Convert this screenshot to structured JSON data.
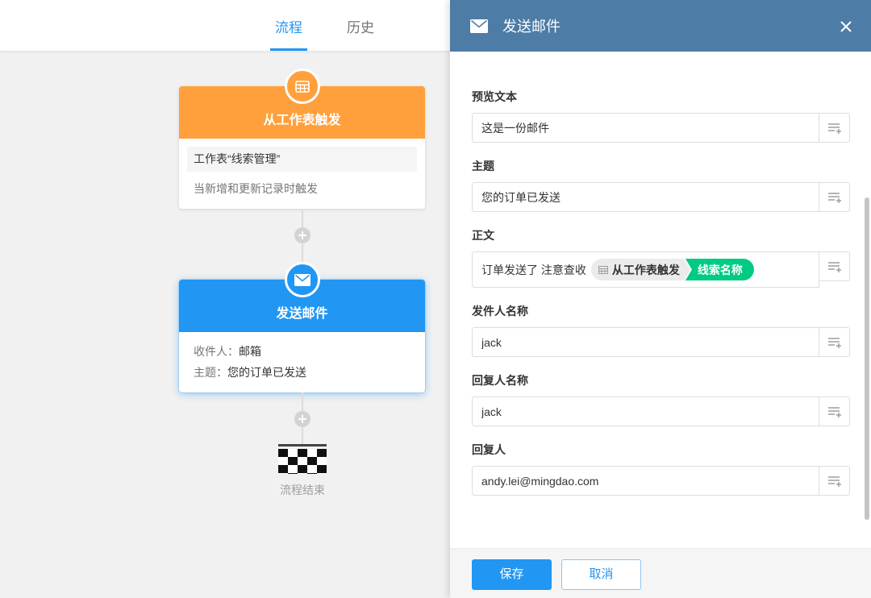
{
  "colors": {
    "accent": "#2196f3",
    "trigger": "#ffa03c",
    "panel_header": "#4d7ca7",
    "chip_green": "#01ca83"
  },
  "tabs": [
    {
      "label": "流程",
      "active": true
    },
    {
      "label": "历史",
      "active": false
    }
  ],
  "flow": {
    "trigger_node": {
      "icon": "table-icon",
      "title": "从工作表触发",
      "sheet": "工作表“线索管理”",
      "description": "当新增和更新记录时触发"
    },
    "add_buttons": [
      {
        "icon": "plus-icon"
      },
      {
        "icon": "plus-icon"
      }
    ],
    "email_node": {
      "icon": "mail-icon",
      "title": "发送邮件",
      "selected": true,
      "recipient_label": "收件人：",
      "recipient_value": "邮箱",
      "subject_label": "主题：",
      "subject_value": "您的订单已发送"
    },
    "end": {
      "icon": "checkered-flag-icon",
      "label": "流程结束"
    }
  },
  "panel": {
    "icon": "mail-icon",
    "title": "发送邮件",
    "close_icon": "close-icon",
    "field_action_icon": "insert-field-icon",
    "fields": {
      "preview_text": {
        "label": "预览文本",
        "value": "这是一份邮件"
      },
      "subject": {
        "label": "主题",
        "value": "您的订单已发送"
      },
      "body": {
        "label": "正文",
        "text": "订单发送了 注意查收",
        "token": {
          "source_icon": "table-icon",
          "source": "从工作表触发",
          "field": "线索名称"
        }
      },
      "sender_name": {
        "label": "发件人名称",
        "value": "jack"
      },
      "reply_name": {
        "label": "回复人名称",
        "value": "jack"
      },
      "reply_to": {
        "label": "回复人",
        "value": "andy.lei@mingdao.com"
      }
    },
    "footer": {
      "save_label": "保存",
      "cancel_label": "取消"
    }
  }
}
